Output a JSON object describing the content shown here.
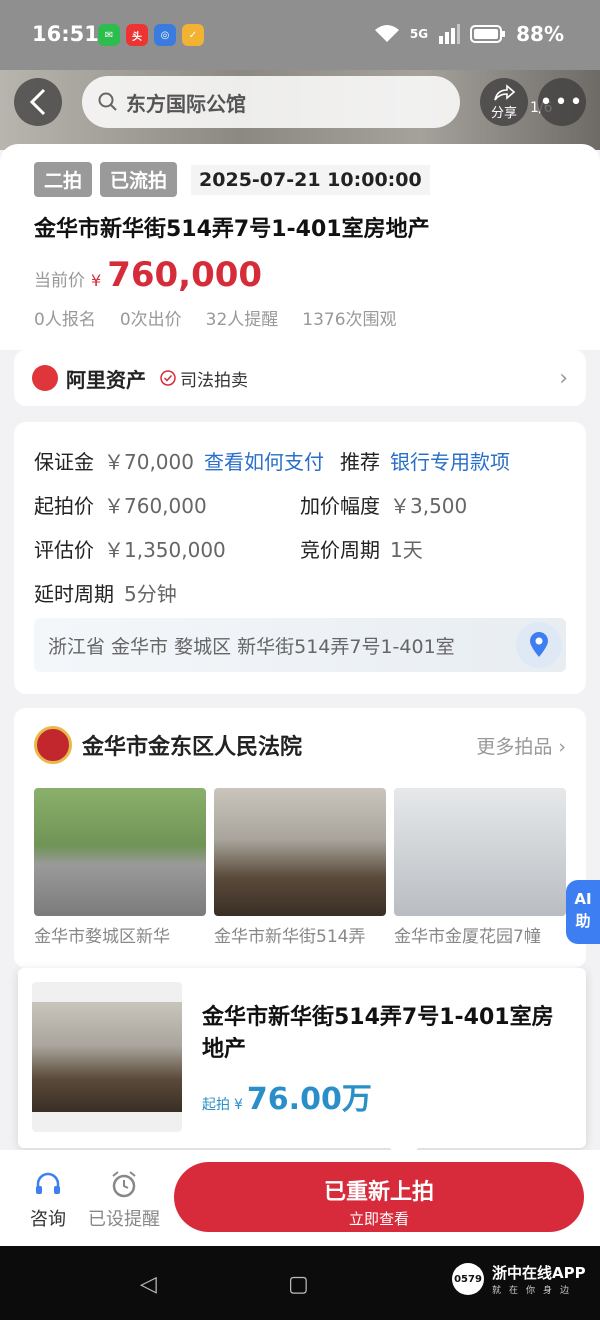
{
  "status": {
    "time": "16:51",
    "battery": "88%",
    "network": "5G",
    "apps": [
      "wechat",
      "toutiao",
      "0579",
      "coupon"
    ]
  },
  "header": {
    "search_text": "东方国际公馆",
    "share_label": "分享",
    "page_indicator": "1/6"
  },
  "listing": {
    "tags": [
      "二拍",
      "已流拍"
    ],
    "datetime": "2025-07-21 10:00:00",
    "title": "金华市新华街514弄7号1-401室房地产",
    "price_label": "当前价",
    "price_currency": "¥",
    "price": "760,000",
    "stats": [
      "0人报名",
      "0次出价",
      "32人提醒",
      "1376次围观"
    ]
  },
  "platform": {
    "name": "阿里资产",
    "badge": "司法拍卖"
  },
  "details": {
    "deposit_label": "保证金",
    "deposit_value": "￥70,000",
    "deposit_link": "查看如何支付",
    "recommend_label": "推荐",
    "recommend_link": "银行专用款项",
    "start_label": "起拍价",
    "start_value": "￥760,000",
    "increment_label": "加价幅度",
    "increment_value": "￥3,500",
    "appraisal_label": "评估价",
    "appraisal_value": "￥1,350,000",
    "period_label": "竞价周期",
    "period_value": "1天",
    "delay_label": "延时周期",
    "delay_value": "5分钟",
    "address": "浙江省 金华市 婺城区 新华街514弄7号1-401室"
  },
  "court": {
    "name": "金华市金东区人民法院",
    "more_label": "更多拍品",
    "items": [
      {
        "caption": "金华市婺城区新华"
      },
      {
        "caption": "金华市新华街514弄"
      },
      {
        "caption": "金华市金厦花园7幢"
      }
    ]
  },
  "ai": {
    "label_line1": "AI",
    "label_line2": "助"
  },
  "popup": {
    "title": "金华市新华街514弄7号1-401室房地产",
    "price_prefix": "起拍",
    "price_currency": "¥",
    "price_value": "76.00万"
  },
  "bottom_bar": {
    "consult_label": "咨询",
    "reminder_label": "已设提醒",
    "cta_line1": "已重新上拍",
    "cta_line2": "立即查看"
  },
  "brand": {
    "name": "浙中在线APP",
    "sub": "就在你身边",
    "logo_text": "0579"
  },
  "colors": {
    "accent_red": "#d72b3b",
    "link_blue": "#2a6fc9",
    "popup_price": "#2a8fc9"
  }
}
